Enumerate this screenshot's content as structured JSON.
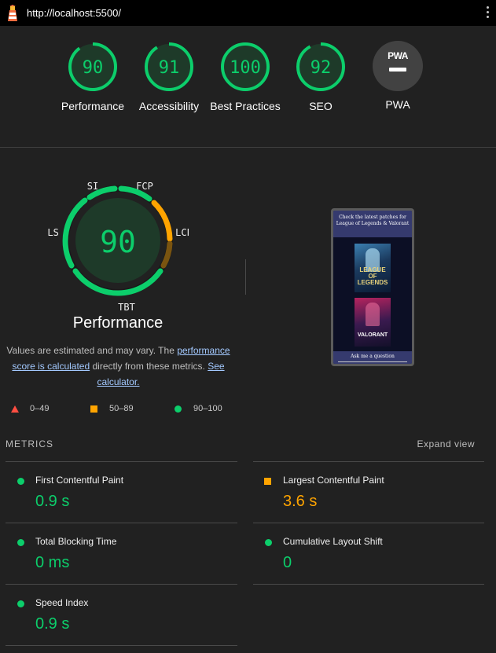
{
  "browser": {
    "url": "http://localhost:5500/",
    "logo_icon": "lighthouse-icon",
    "menu_icon": "kebab-menu-icon"
  },
  "categories": [
    {
      "label": "Performance",
      "score": 90
    },
    {
      "label": "Accessibility",
      "score": 91
    },
    {
      "label": "Best Practices",
      "score": 100
    },
    {
      "label": "SEO",
      "score": 92
    },
    {
      "label": "PWA",
      "badge_text": "PWA",
      "score": null
    }
  ],
  "performance": {
    "score": 90,
    "title": "Performance",
    "gauge_labels": [
      "SI",
      "FCP",
      "LCP",
      "TBT",
      "CLS"
    ],
    "desc_prefix": "Values are estimated and may vary. The ",
    "desc_link": "performance score is calculated",
    "desc_middle": " directly from these metrics. ",
    "calc_link": "See calculator."
  },
  "legend": {
    "fail": "0–49",
    "average": "50–89",
    "pass": "90–100"
  },
  "screenshot": {
    "heading": "Check the latest patches for League of Legends & Valorant",
    "lol_text": "LEAGUE OF LEGENDS",
    "val_text": "VALORANT",
    "button": "Ask me a question"
  },
  "metrics": {
    "title": "METRICS",
    "expand": "Expand view",
    "fcp": {
      "label": "First Contentful Paint",
      "value": "0.9 s"
    },
    "lcp": {
      "label": "Largest Contentful Paint",
      "value": "3.6 s"
    },
    "tbt": {
      "label": "Total Blocking Time",
      "value": "0 ms"
    },
    "cls": {
      "label": "Cumulative Layout Shift",
      "value": "0"
    },
    "si": {
      "label": "Speed Index",
      "value": "0.9 s"
    }
  },
  "colors": {
    "pass": "#0cce6b",
    "average": "#ffa400",
    "fail": "#ff4e42",
    "background": "#212121"
  }
}
